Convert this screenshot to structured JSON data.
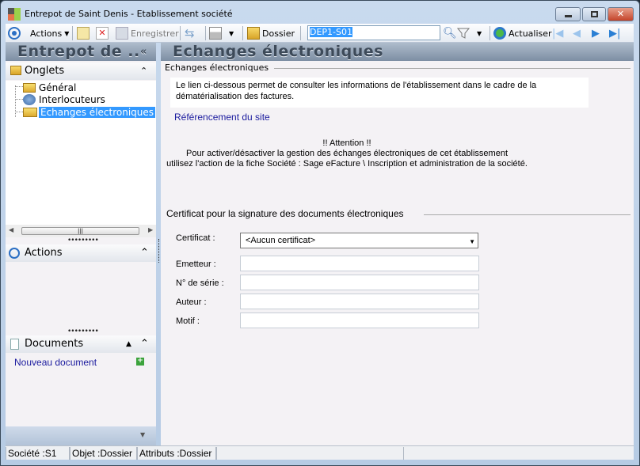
{
  "window": {
    "title": "Entrepot de  Saint  Denis -  Etablissement société"
  },
  "toolbar": {
    "actions": "Actions",
    "save": "Enregistrer",
    "folder": "Dossier",
    "search_value": "DEP1-S01",
    "refresh": "Actualiser"
  },
  "left": {
    "header": "Entrepot de  ..",
    "tabs_title": "Onglets",
    "tabs": [
      {
        "label": "Général"
      },
      {
        "label": "Interlocuteurs"
      },
      {
        "label": "Echanges électroniques"
      }
    ],
    "actions_title": "Actions",
    "documents_title": "Documents",
    "new_document": "Nouveau document"
  },
  "main": {
    "title": "Echanges électroniques",
    "group1": "Echanges électroniques",
    "info": "Le lien ci-dessous permet de consulter les informations de l'établissement dans le cadre de la dématérialisation des factures.",
    "link": "Référencement du site",
    "warning": [
      "!! Attention !!",
      "Pour activer/désactiver la gestion des échanges électroniques de cet établissement",
      "utilisez l'action de la fiche Société : Sage eFacture \\ Inscription et administration de la société."
    ],
    "group2": "Certificat pour la signature des documents électroniques",
    "fields": [
      {
        "label": "Certificat :",
        "value": "<Aucun certificat>"
      },
      {
        "label": "Emetteur :",
        "value": ""
      },
      {
        "label": "N° de série :",
        "value": ""
      },
      {
        "label": "Auteur :",
        "value": ""
      },
      {
        "label": "Motif :",
        "value": ""
      }
    ]
  },
  "status": {
    "company": "Société :S1",
    "object": "Objet :Dossier",
    "attributes": "Attributs :Dossier"
  }
}
